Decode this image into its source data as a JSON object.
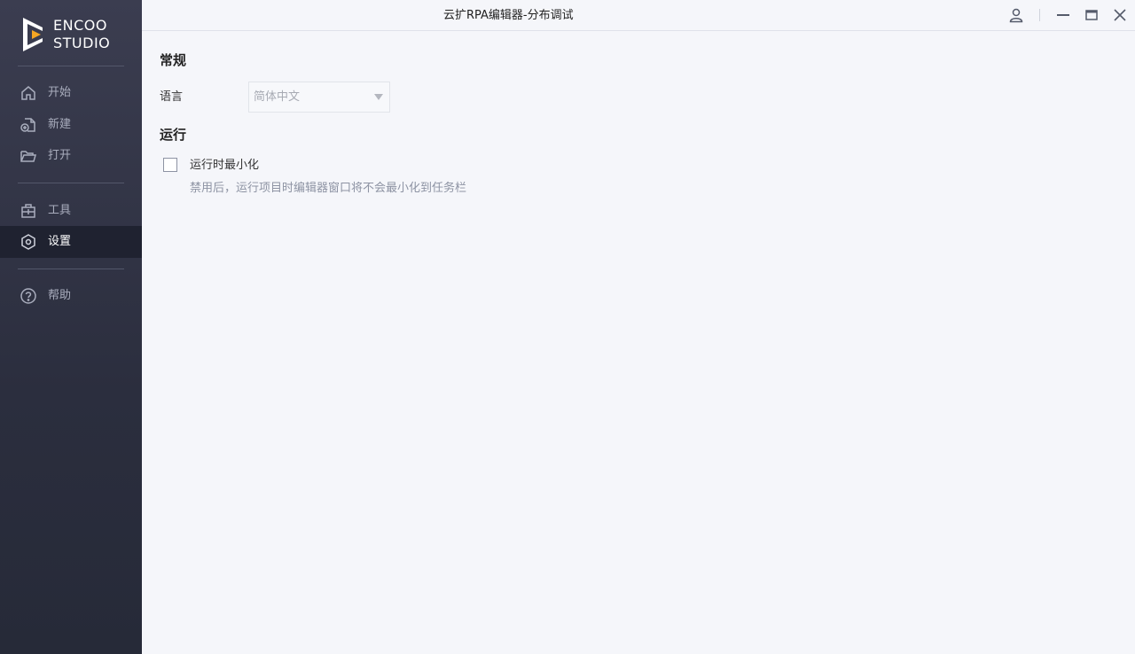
{
  "app": {
    "logo_line1": "ENCOO",
    "logo_line2": "STUDIO",
    "window_title": "云扩RPA编辑器-分布调试",
    "accent_color": "#f5a623",
    "sidebar_active_color": "#1f2230"
  },
  "sidebar": {
    "items": [
      {
        "label": "开始",
        "icon": "home-icon"
      },
      {
        "label": "新建",
        "icon": "new-file-icon"
      },
      {
        "label": "打开",
        "icon": "folder-open-icon"
      },
      {
        "label": "工具",
        "icon": "toolbox-icon"
      },
      {
        "label": "设置",
        "icon": "settings-hexagon-icon",
        "active": true
      },
      {
        "label": "帮助",
        "icon": "help-circle-icon"
      }
    ]
  },
  "titlebar": {
    "icons": [
      "user-icon",
      "minimize-icon",
      "maximize-icon",
      "close-icon"
    ]
  },
  "settings": {
    "general": {
      "title": "常规",
      "language_label": "语言",
      "language_value": "简体中文"
    },
    "run": {
      "title": "运行",
      "minimize_label": "运行时最小化",
      "minimize_checked": false,
      "minimize_hint": "禁用后，运行项目时编辑器窗口将不会最小化到任务栏"
    }
  }
}
